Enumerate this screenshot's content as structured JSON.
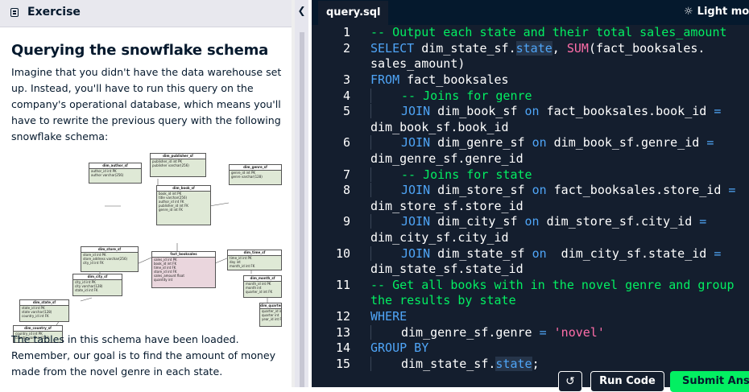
{
  "exercise": {
    "header_label": "Exercise",
    "title": "Querying the snowflake schema",
    "paragraph1": "Imagine that you didn't have the data warehouse set up. Instead, you'll have to run this query on the company's operational database, which means you'll have to rewrite the previous query with the following snowflake schema:",
    "paragraph2": "The tables in this schema have been loaded. Remember, our goal is to find the amount of money made from the novel genre in each state."
  },
  "schema": {
    "tables": [
      {
        "name": "dim_publisher_sf",
        "rows": [
          "publisher_id  int  PK",
          "publisher  varchar(256)"
        ]
      },
      {
        "name": "dim_author_sf",
        "rows": [
          "author_id  int  PK",
          "author  varchar(256)"
        ]
      },
      {
        "name": "dim_genre_sf",
        "rows": [
          "genre_id  int  PK",
          "genre  varchar(128)"
        ]
      },
      {
        "name": "dim_book_sf",
        "rows": [
          "book_id  int  PK",
          "title  varchar(256)",
          "author_id  int  FK",
          "publisher_id  int  FK",
          "genre_id  int  FK"
        ]
      },
      {
        "name": "dim_store_sf",
        "rows": [
          "store_id  int  PK",
          "store_address  varchar(256)",
          "city_id  int  FK"
        ]
      },
      {
        "name": "fact_booksales",
        "rows": [
          "sales_id  int  PK",
          "book_id  int  FK",
          "time_id  int  FK",
          "store_id  int  FK",
          "sales_amount  float",
          "quantity  int"
        ]
      },
      {
        "name": "dim_time_sf",
        "rows": [
          "time_id  int  PK",
          "day  int",
          "month_id  int  FK"
        ]
      },
      {
        "name": "dim_city_sf",
        "rows": [
          "city_id  int  PK",
          "city  varchar(128)",
          "state_id  int  FK"
        ]
      },
      {
        "name": "dim_month_sf",
        "rows": [
          "month_id  int  PK",
          "month  int",
          "quarter_id  int  FK"
        ]
      },
      {
        "name": "dim_state_sf",
        "rows": [
          "state_id  int  PK",
          "state  varchar(128)",
          "country_id  int  FK"
        ]
      },
      {
        "name": "dim_quarter_sf",
        "rows": [
          "quarter_id  int  PK",
          "quarter  int",
          "year_id  int  FK"
        ]
      },
      {
        "name": "dim_country_sf",
        "rows": [
          "country_id  int  PK",
          "country  varchar(128)"
        ]
      }
    ]
  },
  "editor": {
    "tab_label": "query.sql",
    "theme_toggle_label": "Light mode",
    "lines": [
      {
        "n": "1"
      },
      {
        "n": "2"
      },
      {
        "n": ""
      },
      {
        "n": "3"
      },
      {
        "n": "4"
      },
      {
        "n": "5"
      },
      {
        "n": ""
      },
      {
        "n": "6"
      },
      {
        "n": ""
      },
      {
        "n": "7"
      },
      {
        "n": "8"
      },
      {
        "n": ""
      },
      {
        "n": "9"
      },
      {
        "n": ""
      },
      {
        "n": "10"
      },
      {
        "n": ""
      },
      {
        "n": "11"
      },
      {
        "n": ""
      },
      {
        "n": "12"
      },
      {
        "n": "13"
      },
      {
        "n": "14"
      },
      {
        "n": "15"
      }
    ],
    "code": {
      "c1": "-- Output each state and their total sales_amount",
      "c2a": "SELECT",
      "c2b": " dim_state_sf.",
      "c2c": "state",
      "c2d": ", ",
      "c2e": "SUM",
      "c2f": "(fact_booksales.",
      "c2g": "sales_amount)",
      "c3a": "FROM",
      "c3b": " fact_booksales",
      "c4": "-- Joins for genre",
      "c5a": "JOIN",
      "c5b": " dim_book_sf ",
      "c5c": "on",
      "c5d": " fact_booksales.book_id ",
      "c5e": "=",
      "c5f": "dim_book_sf.book_id",
      "c6a": "JOIN",
      "c6b": " dim_genre_sf ",
      "c6c": "on",
      "c6d": " dim_book_sf.genre_id ",
      "c6e": "=",
      "c6f": "dim_genre_sf.genre_id",
      "c7": "-- Joins for state",
      "c8a": "JOIN",
      "c8b": " dim_store_sf ",
      "c8c": "on",
      "c8d": " fact_booksales.store_id ",
      "c8e": "=",
      "c8f": "dim_store_sf.store_id",
      "c9a": "JOIN",
      "c9b": " dim_city_sf ",
      "c9c": "on",
      "c9d": " dim_store_sf.city_id ",
      "c9e": "=",
      "c9f": "dim_city_sf.city_id",
      "c10a": "JOIN",
      "c10b": " dim_state_sf ",
      "c10c": "on",
      "c10d": "  dim_city_sf.state_id ",
      "c10e": "=",
      "c10f": "dim_state_sf.state_id",
      "c11a": "-- Get all books with in the novel genre and group",
      "c11b": "the results by state",
      "c12": "WHERE",
      "c13a": "dim_genre_sf.genre ",
      "c13b": "=",
      "c13c": " 'novel'",
      "c14": "GROUP BY",
      "c15a": "dim_state_sf.",
      "c15b": "state",
      "c15c": ";"
    },
    "run_label": "Run Code",
    "submit_label": "Submit Answer"
  },
  "colors": {
    "comment": "#03ef62",
    "keyword": "#4fa5f7",
    "function": "#ff6ea9",
    "editor_bg": "#141e2e",
    "submit_bg": "#03ef62"
  }
}
